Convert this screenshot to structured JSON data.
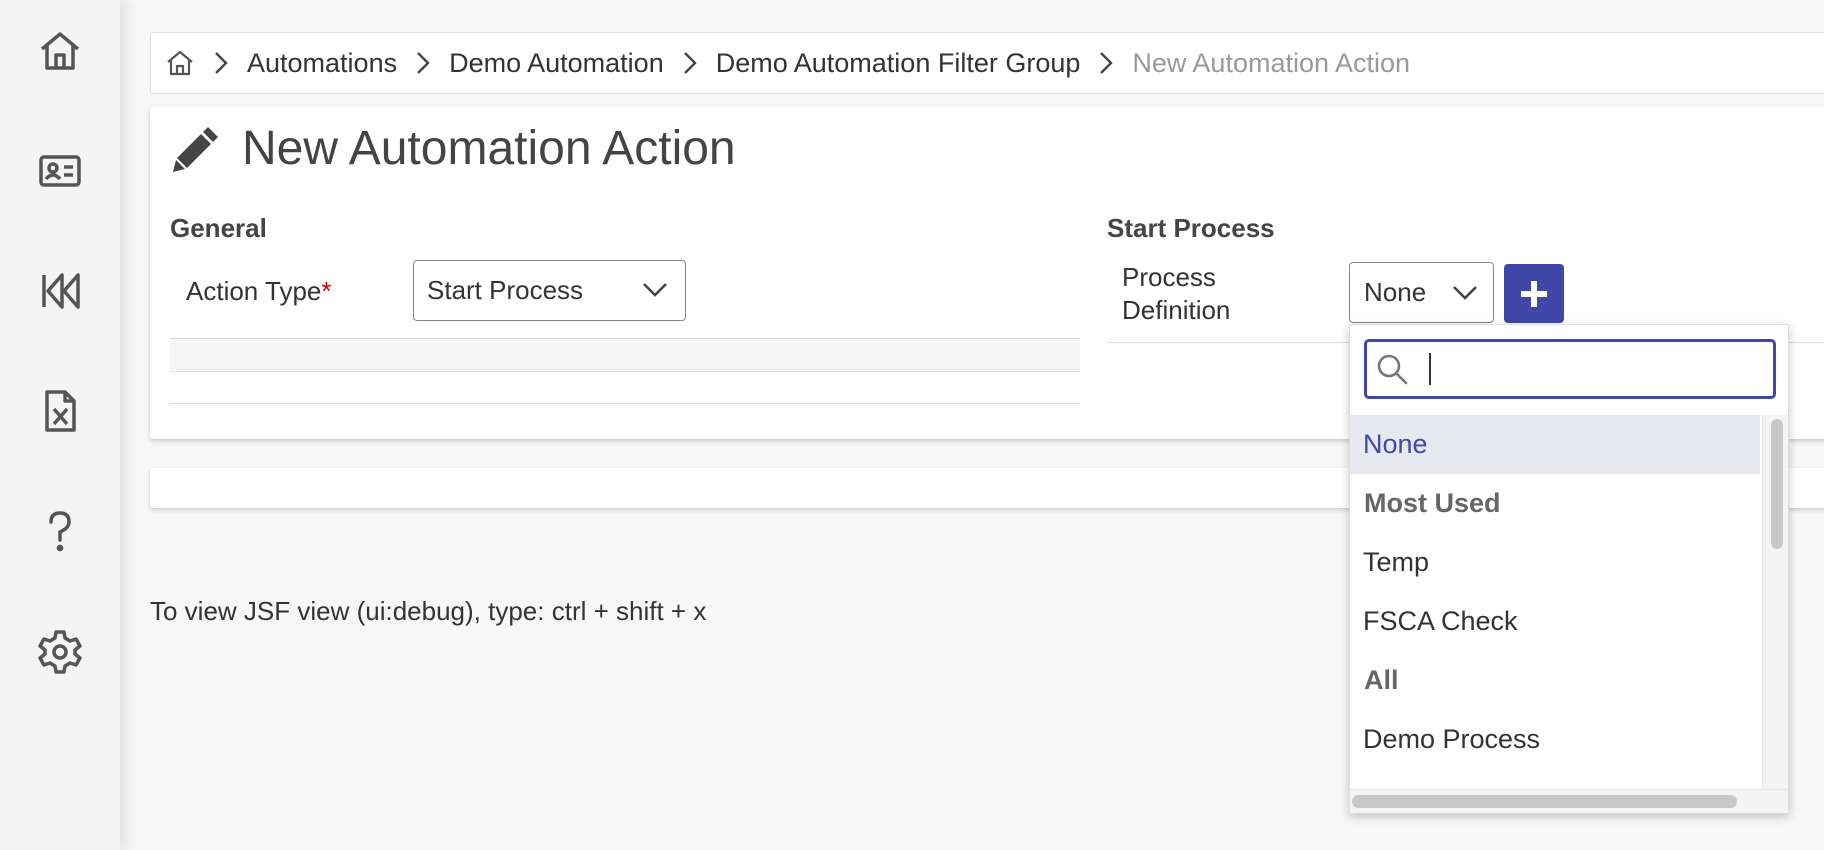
{
  "breadcrumb": {
    "items": [
      "Automations",
      "Demo Automation",
      "Demo Automation Filter Group"
    ],
    "current": "New Automation Action"
  },
  "page": {
    "title": "New Automation Action"
  },
  "general": {
    "section_title": "General",
    "action_type_label": "Action Type",
    "required_marker": "*",
    "action_type_value": "Start Process"
  },
  "start_process": {
    "section_title": "Start Process",
    "process_definition_label_line1": "Process",
    "process_definition_label_line2": "Definition",
    "process_definition_value": "None"
  },
  "dropdown": {
    "search_value": "",
    "selected": "None",
    "groups": [
      {
        "label": "Most Used",
        "options": [
          "Temp",
          "FSCA Check"
        ]
      },
      {
        "label": "All",
        "options": [
          "Demo Process"
        ]
      }
    ]
  },
  "debug_hint": "To view JSF view (ui:debug), type: ctrl + shift + x",
  "colors": {
    "accent": "#3f48a8",
    "required": "#cc0000",
    "muted": "#999999"
  },
  "icons": {
    "sidebar": [
      "home-icon",
      "contact-card-icon",
      "rewind-icon",
      "excel-file-icon",
      "help-icon",
      "settings-icon"
    ],
    "breadcrumb_home": "home-icon",
    "title": "pencil-icon",
    "add": "plus-icon",
    "search": "search-icon",
    "chevron": "chevron-down-icon"
  }
}
